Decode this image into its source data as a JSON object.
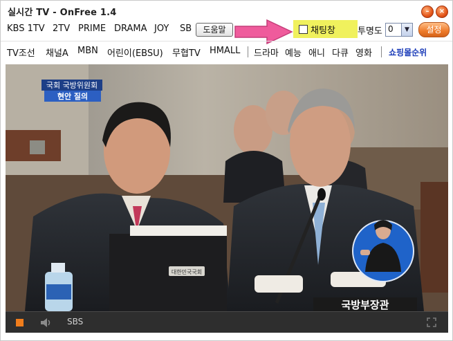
{
  "window": {
    "title": "실시간 TV - OnFree 1.4"
  },
  "toolbar1": {
    "channels": [
      "KBS 1TV",
      "2TV",
      "PRIME",
      "DRAMA",
      "JOY",
      "SB"
    ],
    "help_label": "도움말",
    "chat_label": "채팅창",
    "chat_checked": false,
    "transparency_label": "투명도",
    "transparency_value": "0",
    "settings_label": "설정"
  },
  "toolbar2": {
    "channels": [
      "TV조선",
      "채널A",
      "MBN",
      "어린이(EBSU)",
      "무협TV",
      "HMALL"
    ],
    "genres": [
      "드라마",
      "예능",
      "애니",
      "다큐",
      "영화"
    ],
    "shopping_label": "쇼핑몰순위"
  },
  "video": {
    "caption_line1": "국회 국방위원회",
    "caption_line2": "현안 질의",
    "name_plate": "국방부장관",
    "desk_sign": "대한민국국회"
  },
  "player": {
    "channel_name": "SBS"
  },
  "colors": {
    "accent_orange": "#f07d1c",
    "chat_highlight": "#f0f15d",
    "arrow_pink": "#ef5b9c",
    "shopping_blue": "#1a3bb8"
  }
}
